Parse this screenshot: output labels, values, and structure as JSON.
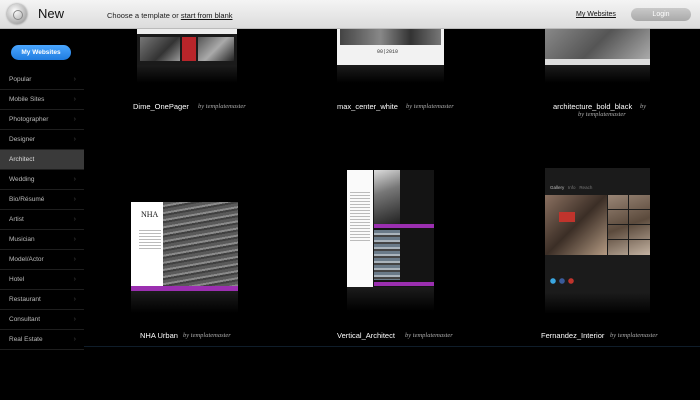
{
  "header": {
    "title": "New",
    "hint_prefix": "Choose a template or",
    "hint_link": "start from blank",
    "my_websites_link": "My Websites",
    "login_label": "Login"
  },
  "sidebar": {
    "my_websites_button": "My Websites",
    "categories": [
      {
        "label": "Popular"
      },
      {
        "label": "Mobile Sites"
      },
      {
        "label": "Photographer"
      },
      {
        "label": "Designer"
      },
      {
        "label": "Architect",
        "active": true
      },
      {
        "label": "Wedding"
      },
      {
        "label": "Bio/Résumé"
      },
      {
        "label": "Artist"
      },
      {
        "label": "Musician"
      },
      {
        "label": "Model/Actor"
      },
      {
        "label": "Hotel"
      },
      {
        "label": "Restaurant"
      },
      {
        "label": "Consultant"
      },
      {
        "label": "Real Estate"
      }
    ]
  },
  "templates": [
    {
      "name": "Dime_OnePager",
      "by": "by templatemaster"
    },
    {
      "name": "max_center_white",
      "by": "by templatemaster",
      "thumb_text": "00|2010"
    },
    {
      "name": "architecture_bold_black",
      "by": "by templatemaster"
    },
    {
      "name": "NHA Urban",
      "by": "by templatemaster",
      "thumb_text": "NHA"
    },
    {
      "name": "Vertical_Architect",
      "by": "by templatemaster"
    },
    {
      "name": "Fernandez_Interior",
      "by": "by templatemaster",
      "thumb_nav": [
        "Gallery",
        "Info",
        "Reach"
      ]
    }
  ]
}
